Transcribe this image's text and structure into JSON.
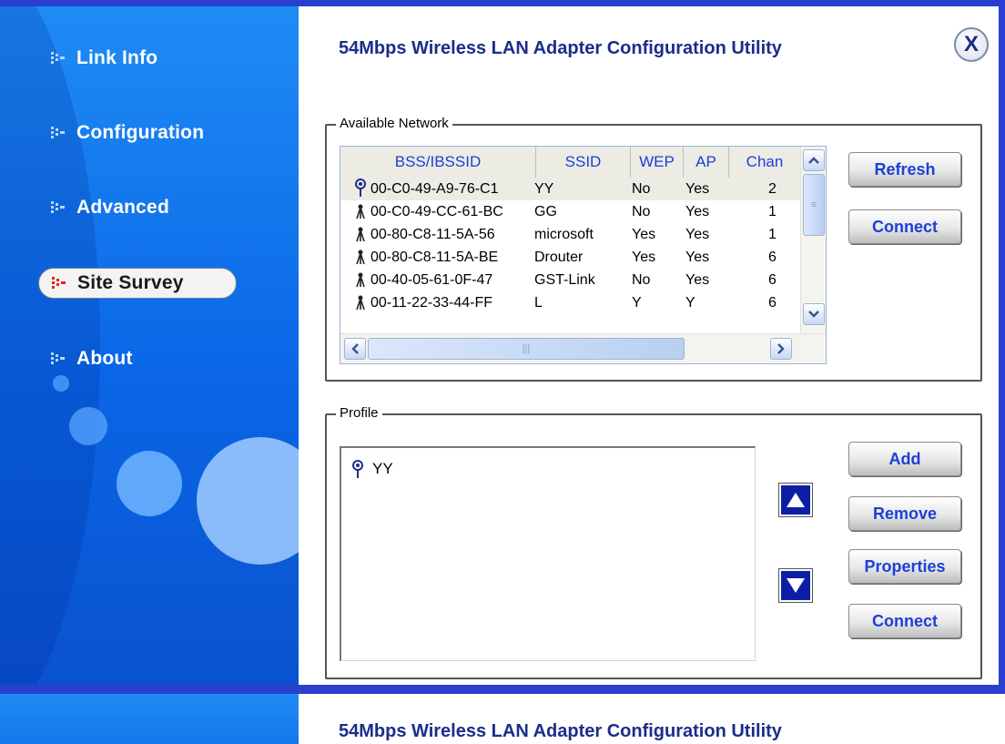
{
  "app": {
    "title": "54Mbps Wireless LAN Adapter Configuration Utility",
    "close_label": "X"
  },
  "sidebar": {
    "items": [
      {
        "label": "Link Info"
      },
      {
        "label": "Configuration"
      },
      {
        "label": "Advanced"
      },
      {
        "label": "Site Survey",
        "active": true
      },
      {
        "label": "About"
      }
    ]
  },
  "available_network": {
    "title": "Available Network",
    "columns": [
      "BSS/IBSSID",
      "SSID",
      "WEP",
      "AP",
      "Chan"
    ],
    "rows": [
      {
        "bssid": "00-C0-49-A9-76-C1",
        "ssid": "YY",
        "wep": "No",
        "ap": "Yes",
        "chan": "2",
        "selected": true
      },
      {
        "bssid": "00-C0-49-CC-61-BC",
        "ssid": "GG",
        "wep": "No",
        "ap": "Yes",
        "chan": "1"
      },
      {
        "bssid": "00-80-C8-11-5A-56",
        "ssid": "microsoft",
        "wep": "Yes",
        "ap": "Yes",
        "chan": "1"
      },
      {
        "bssid": "00-80-C8-11-5A-BE",
        "ssid": "Drouter",
        "wep": "Yes",
        "ap": "Yes",
        "chan": "6"
      },
      {
        "bssid": "00-40-05-61-0F-47",
        "ssid": "GST-Link",
        "wep": "No",
        "ap": "Yes",
        "chan": "6"
      },
      {
        "bssid": "00-11-22-33-44-FF",
        "ssid": "L",
        "wep": "Y",
        "ap": "Y",
        "chan": "6"
      }
    ],
    "buttons": {
      "refresh": "Refresh",
      "connect": "Connect"
    }
  },
  "profile": {
    "title": "Profile",
    "items": [
      "YY"
    ],
    "buttons": {
      "add": "Add",
      "remove": "Remove",
      "properties": "Properties",
      "connect": "Connect"
    }
  },
  "colors": {
    "frame_blue": "#2b3fcf",
    "title_blue": "#1a2e8a",
    "button_text": "#1d3fd8",
    "sidebar_blue": "#0a66e6"
  }
}
